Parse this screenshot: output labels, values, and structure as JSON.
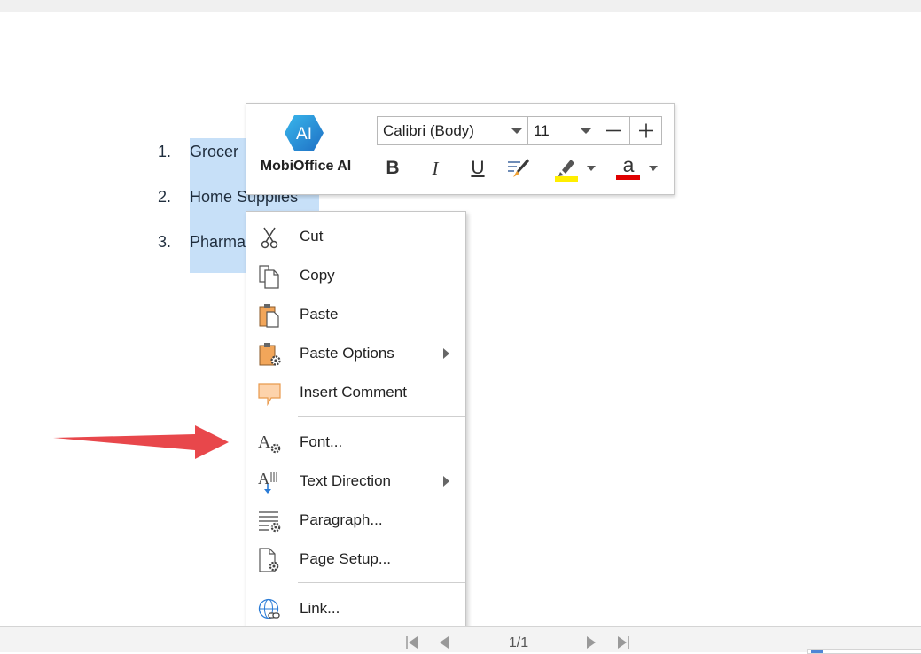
{
  "document": {
    "list": [
      {
        "num": "1.",
        "text": "Grocer"
      },
      {
        "num": "2.",
        "text": "Home Supplies"
      },
      {
        "num": "3.",
        "text": "Pharma"
      }
    ]
  },
  "mini_toolbar": {
    "ai_badge": "AI",
    "ai_name": "MobiOffice AI",
    "font_name": "Calibri (Body)",
    "font_size": "11",
    "decrease_label": "−",
    "increase_label": "+",
    "bold_label": "B",
    "italic_label": "I",
    "underline_label": "U",
    "font_color_label": "a",
    "highlight_color": "#ffee00",
    "font_color": "#e00000"
  },
  "context_menu": {
    "items": [
      {
        "label": "Cut",
        "icon": "scissors-icon",
        "submenu": false
      },
      {
        "label": "Copy",
        "icon": "copy-icon",
        "submenu": false
      },
      {
        "label": "Paste",
        "icon": "paste-icon",
        "submenu": false
      },
      {
        "label": "Paste Options",
        "icon": "paste-options-icon",
        "submenu": true
      },
      {
        "label": "Insert Comment",
        "icon": "comment-icon",
        "submenu": false
      },
      {
        "label": "Font...",
        "icon": "font-settings-icon",
        "submenu": false
      },
      {
        "label": "Text Direction",
        "icon": "text-direction-icon",
        "submenu": true
      },
      {
        "label": "Paragraph...",
        "icon": "paragraph-icon",
        "submenu": false
      },
      {
        "label": "Page Setup...",
        "icon": "page-setup-icon",
        "submenu": false
      },
      {
        "label": "Link...",
        "icon": "link-icon",
        "submenu": false
      }
    ]
  },
  "status_bar": {
    "page_indicator": "1/1"
  },
  "colors": {
    "selection": "#c7e0f8",
    "ai_logo": "#2a8fd6",
    "annotation_arrow": "#e8474b"
  }
}
